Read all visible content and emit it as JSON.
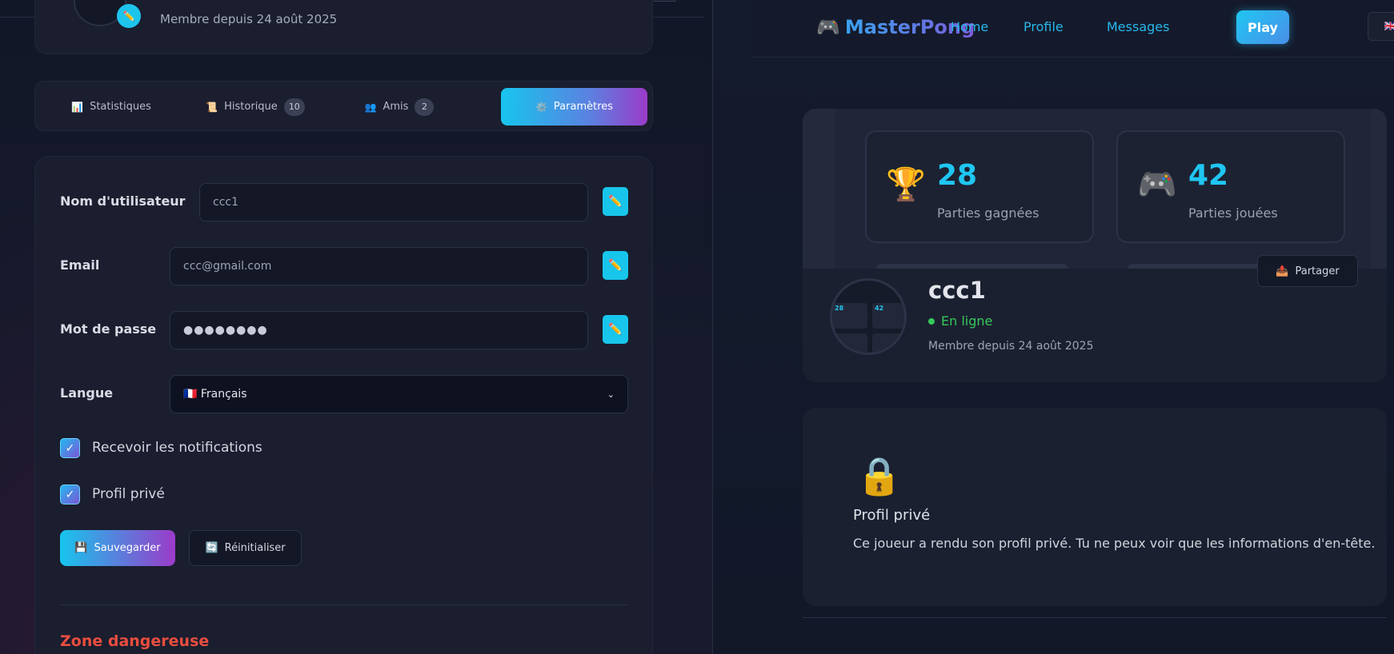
{
  "left": {
    "header": {
      "member_since": "Membre depuis 24 août 2025"
    },
    "tabs": [
      {
        "icon": "📊",
        "label": "Statistiques",
        "count": null
      },
      {
        "icon": "📜",
        "label": "Historique",
        "count": "10"
      },
      {
        "icon": "👥",
        "label": "Amis",
        "count": "2"
      },
      {
        "icon": "⚙️",
        "label": "Paramètres",
        "count": null
      }
    ],
    "settings": {
      "username_label": "Nom d'utilisateur",
      "username_value": "ccc1",
      "email_label": "Email",
      "email_value": "ccc@gmail.com",
      "password_label": "Mot de passe",
      "password_value": "●●●●●●●●",
      "language_label": "Langue",
      "language_value": "🇫🇷 Français",
      "edit_icon": "✏️",
      "notifications_label": "Recevoir les notifications",
      "private_label": "Profil privé",
      "check_mark": "✓",
      "save_icon": "💾",
      "save_label": "Sauvegarder",
      "reset_icon": "🔄",
      "reset_label": "Réinitialiser",
      "danger_zone": "Zone dangereuse"
    }
  },
  "right": {
    "nav": {
      "brand_icon": "🎮",
      "brand": "MasterPong",
      "links": [
        "Home",
        "Profile",
        "Messages"
      ],
      "play": "Play",
      "lang": "🇬🇧 EN"
    },
    "stats": [
      {
        "icon": "🏆",
        "value": "28",
        "label": "Parties gagnées"
      },
      {
        "icon": "🎮",
        "value": "42",
        "label": "Parties jouées"
      }
    ],
    "profile": {
      "share_icon": "📤",
      "share_label": "Partager",
      "username": "ccc1",
      "status": "En ligne",
      "member_since": "Membre depuis 24 août 2025"
    },
    "private_notice": {
      "icon": "🔒",
      "title": "Profil privé",
      "description": "Ce joueur a rendu son profil privé. Tu ne peux voir que les informations d'en-tête."
    }
  }
}
